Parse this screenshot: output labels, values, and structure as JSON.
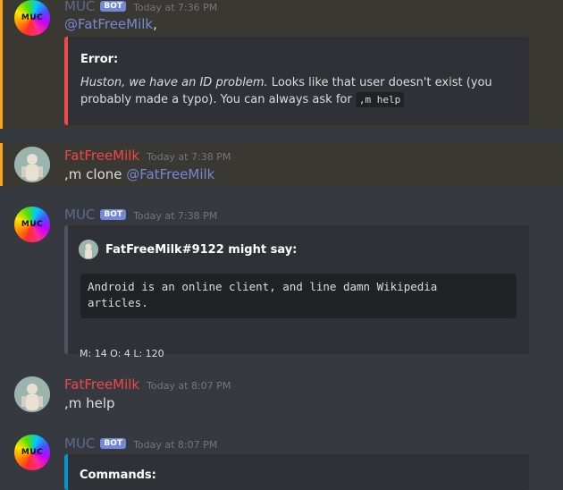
{
  "colors": {
    "background": "#36393f",
    "mention": "#7289da",
    "bot_badge": "#7289da",
    "error_stripe": "#f04747",
    "commands_stripe": "#0096cf",
    "highlight_stripe": "#faa61a"
  },
  "messages": [
    {
      "username": "MUC",
      "badge": "BOT",
      "timestamp": "Today at 7:36 PM",
      "avatar_text": "MUC",
      "mention": "@FatFreeMilk",
      "after_mention": ",",
      "embed": {
        "title": "Error:",
        "italic": "Huston, we have an ID problem.",
        "text": " Looks like that user doesn't exist (you probably made a typo). You can always ask for ",
        "code": ",m help"
      }
    },
    {
      "username": "FatFreeMilk",
      "timestamp": "Today at 7:38 PM",
      "text": ",m clone ",
      "mention": "@FatFreeMilk"
    },
    {
      "username": "MUC",
      "badge": "BOT",
      "timestamp": "Today at 7:38 PM",
      "avatar_text": "MUC",
      "embed": {
        "author": "FatFreeMilk#9122 might say:",
        "code_line1": "Android is an online client, and line damn Wikipedia",
        "code_line2": "articles.",
        "footer": "M: 14 O: 4 L: 120"
      }
    },
    {
      "username": "FatFreeMilk",
      "timestamp": "Today at 8:07 PM",
      "text": ",m help"
    },
    {
      "username": "MUC",
      "badge": "BOT",
      "timestamp": "Today at 8:07 PM",
      "avatar_text": "MUC",
      "embed": {
        "title": "Commands:"
      }
    }
  ]
}
